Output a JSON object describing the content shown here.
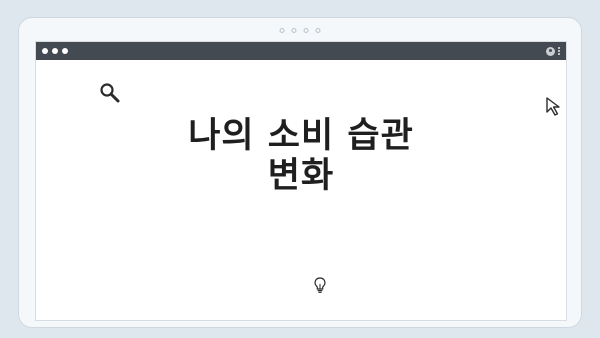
{
  "window": {
    "title_lines": [
      "나의 소비 습관",
      "변화"
    ]
  },
  "icons": {
    "search": "search-icon",
    "cursor": "cursor-arrow-icon",
    "bulb": "lightbulb-icon",
    "user": "user-icon",
    "menu": "kebab-menu-icon"
  },
  "colors": {
    "background": "#dfe7ee",
    "titlebar": "#444a51",
    "text": "#1f1f1f"
  }
}
